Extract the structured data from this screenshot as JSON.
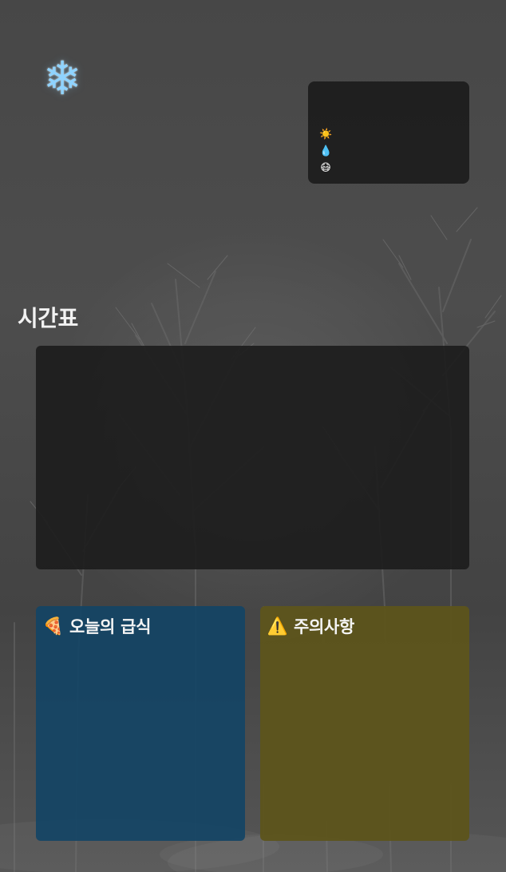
{
  "header": {
    "icon": "snowflake-icon"
  },
  "weather": {
    "items": [
      {
        "icon": "sun-icon",
        "label": ""
      },
      {
        "icon": "droplet-icon",
        "label": ""
      },
      {
        "icon": "face-icon",
        "label": ""
      }
    ]
  },
  "timetable": {
    "title": "시간표"
  },
  "meal": {
    "icon": "pizza-icon",
    "title": "오늘의 급식"
  },
  "caution": {
    "icon": "warning-icon",
    "title": "주의사항"
  },
  "colors": {
    "background": "#4a4a4a",
    "panel": "#1c1c1c",
    "meal_card": "#134465",
    "caution_card": "#5d541c"
  }
}
